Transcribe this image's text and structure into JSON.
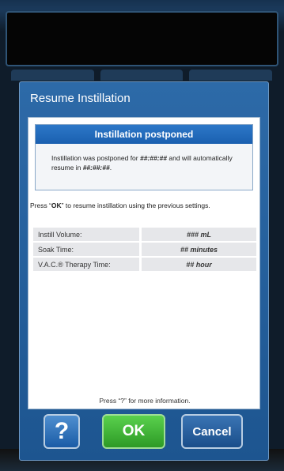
{
  "dialog": {
    "title": "Resume Instillation",
    "banner_title": "Instillation postponed",
    "banner_text_1": "Instillation was postponed for ",
    "postponed_duration": "##:##:##",
    "banner_text_2": " and will automatically resume in ",
    "resume_countdown": "##:##:##",
    "banner_text_3": ".",
    "instruction_1": "Press “",
    "instruction_key": "OK",
    "instruction_2": "” to resume instillation using the previous settings.",
    "settings": [
      {
        "label": "Instill Volume:",
        "value": "### mL"
      },
      {
        "label": "Soak Time:",
        "value": "## minutes"
      },
      {
        "label": "V.A.C.® Therapy Time:",
        "value": "## hour"
      }
    ],
    "footer_note": "Press “?” for more information."
  },
  "buttons": {
    "help": "?",
    "ok": "OK",
    "cancel": "Cancel"
  },
  "colors": {
    "dialog_blue": "#1d5590",
    "banner_blue": "#1a5fb0",
    "ok_green": "#2d9a26"
  }
}
